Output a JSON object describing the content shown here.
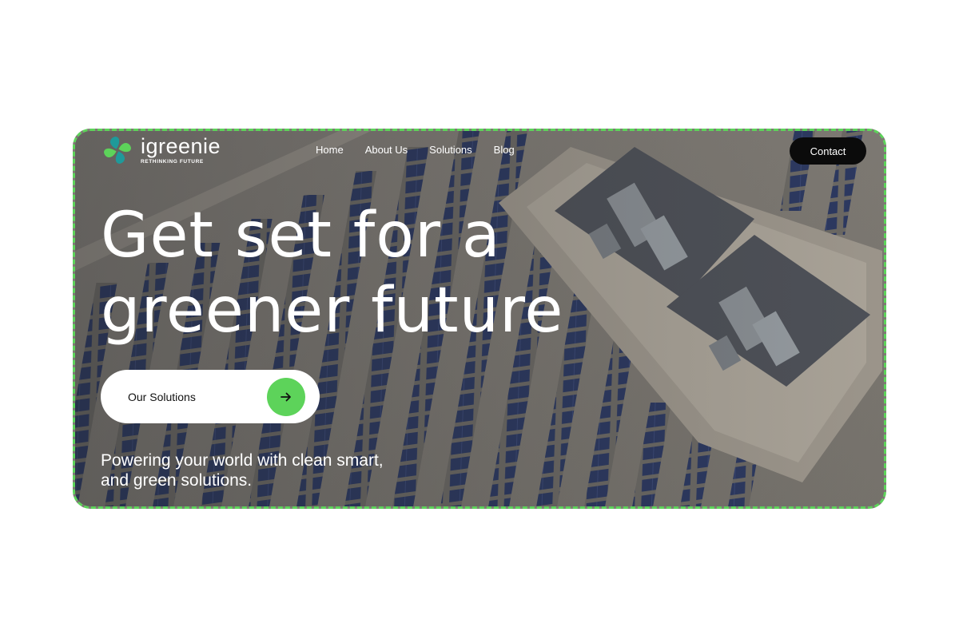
{
  "brand": {
    "name": "igreenie",
    "tagline": "RETHINKING FUTURE",
    "logo_icon": "leaf-clover-icon",
    "colors": {
      "accent": "#5dd35a",
      "accent_teal": "#1f9a9a",
      "dark": "#0b0b0b"
    }
  },
  "nav": {
    "items": [
      {
        "label": "Home"
      },
      {
        "label": "About Us"
      },
      {
        "label": "Solutions"
      },
      {
        "label": "Blog"
      }
    ],
    "contact_label": "Contact"
  },
  "hero": {
    "headline_line1": "Get set for a",
    "headline_line2": "greener future",
    "cta_label": "Our Solutions",
    "cta_icon": "arrow-right-icon",
    "subtext": "Powering your world with clean smart, and green solutions.",
    "background": "aerial-rooftop-solar-panels-image"
  }
}
